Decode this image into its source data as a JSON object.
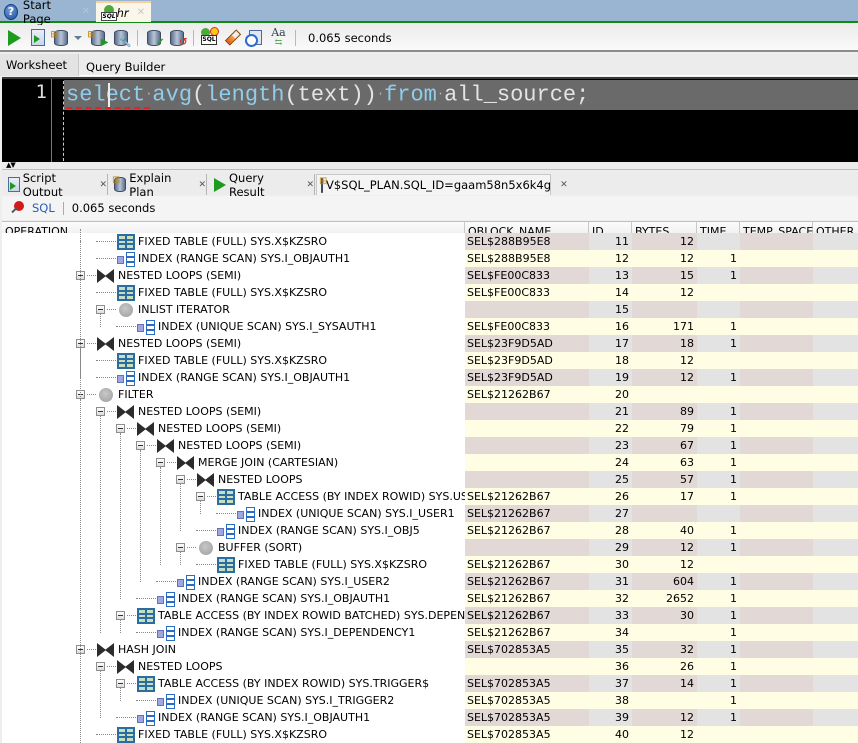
{
  "doc_tabs": [
    {
      "label": "Start Page",
      "icon": "help-icon",
      "active": false
    },
    {
      "label": "hr",
      "icon": "sql-worksheet-icon",
      "active": true
    }
  ],
  "toolbar": {
    "buttons": [
      "run-statement",
      "run-script",
      "explain-plan",
      "autotrace",
      "sql-tuning-advisor",
      "commit",
      "rollback",
      "unshared-sql-worksheet",
      "clear",
      "sql-history",
      "to-upper-lower-initcap"
    ],
    "status": "0.065 seconds"
  },
  "editor_tabs": {
    "worksheet": "Worksheet",
    "query_builder": "Query Builder"
  },
  "editor": {
    "line_number": "1",
    "tokens": [
      {
        "t": "select",
        "k": true
      },
      {
        "t": "·",
        "d": true
      },
      {
        "t": "avg",
        "k": true
      },
      {
        "t": "(",
        "k": false
      },
      {
        "t": "length",
        "k": true
      },
      {
        "t": "(text))",
        "k": false
      },
      {
        "t": "·",
        "d": true
      },
      {
        "t": "from",
        "k": true
      },
      {
        "t": "·",
        "d": true
      },
      {
        "t": "all_source;",
        "k": false
      }
    ]
  },
  "result_tabs": [
    {
      "label": "Script Output",
      "icon": "script-output-icon"
    },
    {
      "label": "Explain Plan",
      "icon": "explain-plan-icon"
    },
    {
      "label": "Query Result",
      "icon": "query-result-icon"
    },
    {
      "label": "V$SQL_PLAN.SQL_ID=gaam58n5x6k4g",
      "icon": "sql-plan-icon",
      "active": true
    }
  ],
  "result_toolbar": {
    "sql_label": "SQL",
    "status": "0.065 seconds"
  },
  "grid": {
    "columns": [
      "OPERATION",
      "QBLOCK_NAME",
      "ID",
      "BYTES",
      "TIME",
      "TEMP_SPACE",
      "OTHER"
    ],
    "rows": [
      {
        "depth": 3,
        "icon": "table",
        "exp": false,
        "op": "FIXED TABLE (FULL) SYS.X$KZSRO",
        "qb": "SEL$288B95E8",
        "id": "11",
        "bytes": "12",
        "time": ""
      },
      {
        "depth": 3,
        "icon": "index",
        "exp": false,
        "op": "INDEX (RANGE SCAN) SYS.I_OBJAUTH1",
        "qb": "SEL$288B95E8",
        "id": "12",
        "bytes": "12",
        "time": "1"
      },
      {
        "depth": 2,
        "icon": "join",
        "exp": true,
        "op": "NESTED LOOPS (SEMI)",
        "qb": "SEL$FE00C833",
        "id": "13",
        "bytes": "15",
        "time": "1"
      },
      {
        "depth": 3,
        "icon": "table",
        "exp": false,
        "op": "FIXED TABLE (FULL) SYS.X$KZSRO",
        "qb": "SEL$FE00C833",
        "id": "14",
        "bytes": "12",
        "time": ""
      },
      {
        "depth": 3,
        "icon": "circle",
        "exp": true,
        "op": "INLIST ITERATOR",
        "qb": "",
        "id": "15",
        "bytes": "",
        "time": ""
      },
      {
        "depth": 4,
        "icon": "index",
        "exp": false,
        "op": "INDEX (UNIQUE SCAN) SYS.I_SYSAUTH1",
        "qb": "SEL$FE00C833",
        "id": "16",
        "bytes": "171",
        "time": "1"
      },
      {
        "depth": 2,
        "icon": "join",
        "exp": true,
        "op": "NESTED LOOPS (SEMI)",
        "qb": "SEL$23F9D5AD",
        "id": "17",
        "bytes": "18",
        "time": "1"
      },
      {
        "depth": 3,
        "icon": "table",
        "exp": false,
        "op": "FIXED TABLE (FULL) SYS.X$KZSRO",
        "qb": "SEL$23F9D5AD",
        "id": "18",
        "bytes": "12",
        "time": ""
      },
      {
        "depth": 3,
        "icon": "index",
        "exp": false,
        "op": "INDEX (RANGE SCAN) SYS.I_OBJAUTH1",
        "qb": "SEL$23F9D5AD",
        "id": "19",
        "bytes": "12",
        "time": "1"
      },
      {
        "depth": 2,
        "icon": "circle",
        "exp": true,
        "op": "FILTER",
        "qb": "SEL$21262B67",
        "id": "20",
        "bytes": "",
        "time": ""
      },
      {
        "depth": 3,
        "icon": "join",
        "exp": true,
        "op": "NESTED LOOPS (SEMI)",
        "qb": "",
        "id": "21",
        "bytes": "89",
        "time": "1"
      },
      {
        "depth": 4,
        "icon": "join",
        "exp": true,
        "op": "NESTED LOOPS (SEMI)",
        "qb": "",
        "id": "22",
        "bytes": "79",
        "time": "1"
      },
      {
        "depth": 5,
        "icon": "join",
        "exp": true,
        "op": "NESTED LOOPS (SEMI)",
        "qb": "",
        "id": "23",
        "bytes": "67",
        "time": "1"
      },
      {
        "depth": 6,
        "icon": "join",
        "exp": true,
        "op": "MERGE JOIN (CARTESIAN)",
        "qb": "",
        "id": "24",
        "bytes": "63",
        "time": "1"
      },
      {
        "depth": 7,
        "icon": "join",
        "exp": true,
        "op": "NESTED LOOPS",
        "qb": "",
        "id": "25",
        "bytes": "57",
        "time": "1"
      },
      {
        "depth": 8,
        "icon": "table",
        "exp": true,
        "op": "TABLE ACCESS (BY INDEX ROWID) SYS.USER$",
        "qb": "SEL$21262B67",
        "id": "26",
        "bytes": "17",
        "time": "1"
      },
      {
        "depth": 9,
        "icon": "index",
        "exp": false,
        "op": "INDEX (UNIQUE SCAN) SYS.I_USER1",
        "qb": "SEL$21262B67",
        "id": "27",
        "bytes": "",
        "time": ""
      },
      {
        "depth": 8,
        "icon": "index",
        "exp": false,
        "op": "INDEX (RANGE SCAN) SYS.I_OBJ5",
        "qb": "SEL$21262B67",
        "id": "28",
        "bytes": "40",
        "time": "1"
      },
      {
        "depth": 7,
        "icon": "circle",
        "exp": true,
        "op": "BUFFER (SORT)",
        "qb": "",
        "id": "29",
        "bytes": "12",
        "time": "1"
      },
      {
        "depth": 8,
        "icon": "table",
        "exp": false,
        "op": "FIXED TABLE (FULL) SYS.X$KZSRO",
        "qb": "SEL$21262B67",
        "id": "30",
        "bytes": "12",
        "time": ""
      },
      {
        "depth": 6,
        "icon": "index",
        "exp": false,
        "op": "INDEX (RANGE SCAN) SYS.I_USER2",
        "qb": "SEL$21262B67",
        "id": "31",
        "bytes": "604",
        "time": "1"
      },
      {
        "depth": 5,
        "icon": "index",
        "exp": false,
        "op": "INDEX (RANGE SCAN) SYS.I_OBJAUTH1",
        "qb": "SEL$21262B67",
        "id": "32",
        "bytes": "2652",
        "time": "1"
      },
      {
        "depth": 4,
        "icon": "table",
        "exp": true,
        "op": "TABLE ACCESS (BY INDEX ROWID BATCHED) SYS.DEPENDENCY$",
        "qb": "SEL$21262B67",
        "id": "33",
        "bytes": "30",
        "time": "1"
      },
      {
        "depth": 5,
        "icon": "index",
        "exp": false,
        "op": "INDEX (RANGE SCAN) SYS.I_DEPENDENCY1",
        "qb": "SEL$21262B67",
        "id": "34",
        "bytes": "",
        "time": "1"
      },
      {
        "depth": 2,
        "icon": "join",
        "exp": true,
        "op": "HASH JOIN",
        "qb": "SEL$702853A5",
        "id": "35",
        "bytes": "32",
        "time": "1"
      },
      {
        "depth": 3,
        "icon": "join",
        "exp": true,
        "op": "NESTED LOOPS",
        "qb": "",
        "id": "36",
        "bytes": "26",
        "time": "1"
      },
      {
        "depth": 4,
        "icon": "table",
        "exp": true,
        "op": "TABLE ACCESS (BY INDEX ROWID) SYS.TRIGGER$",
        "qb": "SEL$702853A5",
        "id": "37",
        "bytes": "14",
        "time": "1"
      },
      {
        "depth": 5,
        "icon": "index",
        "exp": false,
        "op": "INDEX (UNIQUE SCAN) SYS.I_TRIGGER2",
        "qb": "SEL$702853A5",
        "id": "38",
        "bytes": "",
        "time": "1"
      },
      {
        "depth": 4,
        "icon": "index",
        "exp": false,
        "op": "INDEX (RANGE SCAN) SYS.I_OBJAUTH1",
        "qb": "SEL$702853A5",
        "id": "39",
        "bytes": "12",
        "time": "1"
      },
      {
        "depth": 3,
        "icon": "table",
        "exp": false,
        "op": "FIXED TABLE (FULL) SYS.X$KZSRO",
        "qb": "SEL$702853A5",
        "id": "40",
        "bytes": "12",
        "time": ""
      }
    ]
  }
}
